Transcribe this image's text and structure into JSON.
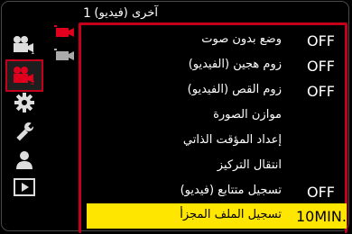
{
  "header": {
    "page_number": "1",
    "title": "آخرى (فيديو)"
  },
  "sidebar": {
    "items": [
      {
        "icon": "video-icon",
        "badge": "1"
      },
      {
        "icon": "video-icon",
        "badge": "2"
      },
      {
        "icon": "gear-icon"
      },
      {
        "icon": "wrench-icon"
      },
      {
        "icon": "person-icon"
      },
      {
        "icon": "playback-icon"
      }
    ]
  },
  "subtabs": [
    {
      "icon": "video-red-icon"
    },
    {
      "icon": "video-grey-icon"
    }
  ],
  "menu": {
    "rows": [
      {
        "label": "وضع بدون صوت",
        "value": "OFF"
      },
      {
        "label": "زوم هجين (الفيديو)",
        "value": "OFF"
      },
      {
        "label": "زوم القص (الفيديو)",
        "value": "OFF"
      },
      {
        "label": "موازن الصورة",
        "value": ""
      },
      {
        "label": "إعداد المؤقت الذاتي",
        "value": ""
      },
      {
        "label": "انتقال التركيز",
        "value": ""
      },
      {
        "label": "تسجيل متتابع (فيديو)",
        "value": "OFF"
      },
      {
        "label": "تسجيل الملف المجزأ",
        "value": "10MIN."
      }
    ]
  },
  "colors": {
    "accent": "#c4001c",
    "highlight": "#ffe600"
  }
}
